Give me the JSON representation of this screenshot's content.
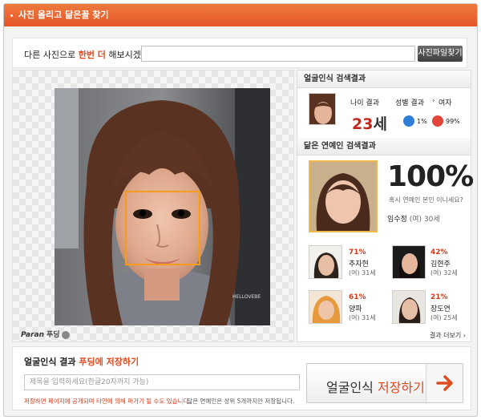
{
  "titlebar": {
    "title": "사진 올리고 닮은꼴 찾기"
  },
  "search": {
    "question_prefix": "다른 사진으로 ",
    "question_highlight": "한번 더",
    "question_suffix": " 해보시겠어요?",
    "input_value": "",
    "file_button": "사진파일찾기"
  },
  "photo_panel": {
    "brand": "Paran",
    "brand_suffix": "푸딩",
    "watermark": "HELLOVEBE"
  },
  "face_result": {
    "header": "얼굴인식 검색결과",
    "age_label": "나이 결과",
    "age_value": "23",
    "age_unit": "세",
    "gender_label": "성별 결과",
    "gender_result": "여자",
    "male_pct": "1%",
    "female_pct": "99%"
  },
  "celeb_result": {
    "header": "닮은 연예인 검색결과",
    "top_pct": "100%",
    "top_question": "혹시 연예인 본인 이니세요?",
    "top_name": "임수정",
    "top_sub": "(여) 30세",
    "candidates": [
      {
        "pct": "71%",
        "name": "추자현",
        "sub": "(여) 31세"
      },
      {
        "pct": "42%",
        "name": "김현주",
        "sub": "(여) 32세"
      },
      {
        "pct": "61%",
        "name": "양파",
        "sub": "(여) 31세"
      },
      {
        "pct": "21%",
        "name": "장도연",
        "sub": "(여) 25세"
      }
    ],
    "more_label": "결과 더보기"
  },
  "save": {
    "title_prefix": "얼굴인식 결과 ",
    "title_highlight": "푸딩에 저장하기",
    "input_placeholder": "제목을 입력하세요(한글20자까지 가능)",
    "note_warning": "저장하면 페이지에 공개되며 타인에 의해 퍼가기 될 수도 있습니다",
    "note_info": "닮은 연예인은 상위 5개까지만 저장됩니다.",
    "button_prefix": "얼굴인식 ",
    "button_highlight": "저장하기"
  },
  "colors": {
    "accent": "#e5562a",
    "highlight": "#e04a1f",
    "face_box": "#f39c1d",
    "male": "#2f7fd8",
    "female": "#e2453a"
  }
}
